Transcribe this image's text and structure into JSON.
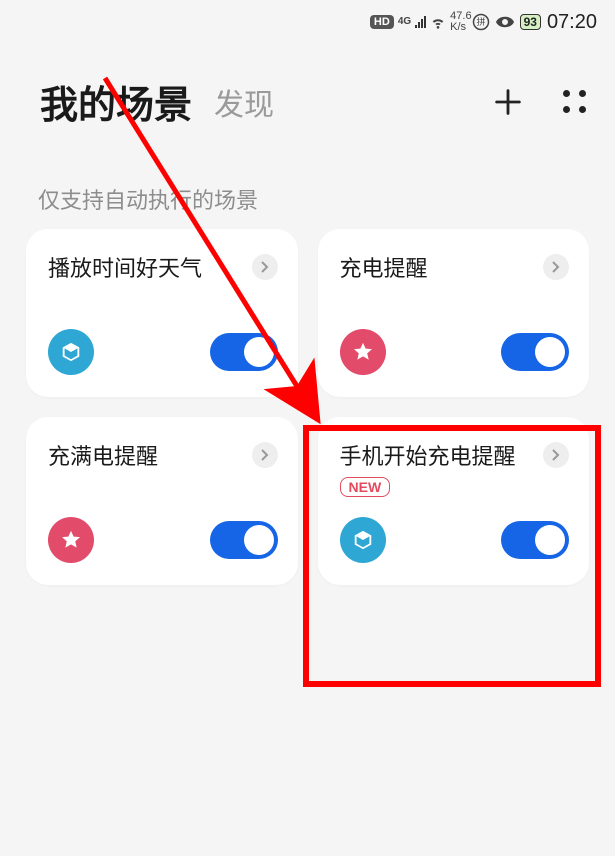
{
  "status": {
    "hd": "HD",
    "net4g": "4G",
    "speed_top": "47.6",
    "speed_bot": "K/s",
    "battery": "93",
    "time": "07:20"
  },
  "header": {
    "title_primary": "我的场景",
    "title_secondary": "发现"
  },
  "section_label": "仅支持自动执行的场景",
  "cards": [
    {
      "title": "播放时间好天气",
      "icon": "cube",
      "icon_color": "blue",
      "toggle": true
    },
    {
      "title": "充电提醒",
      "icon": "star",
      "icon_color": "pink",
      "toggle": true
    },
    {
      "title": "充满电提醒",
      "icon": "star",
      "icon_color": "pink",
      "toggle": true
    },
    {
      "title": "手机开始充电提醒",
      "badge": "NEW",
      "icon": "cube",
      "icon_color": "blue",
      "toggle": true
    }
  ]
}
